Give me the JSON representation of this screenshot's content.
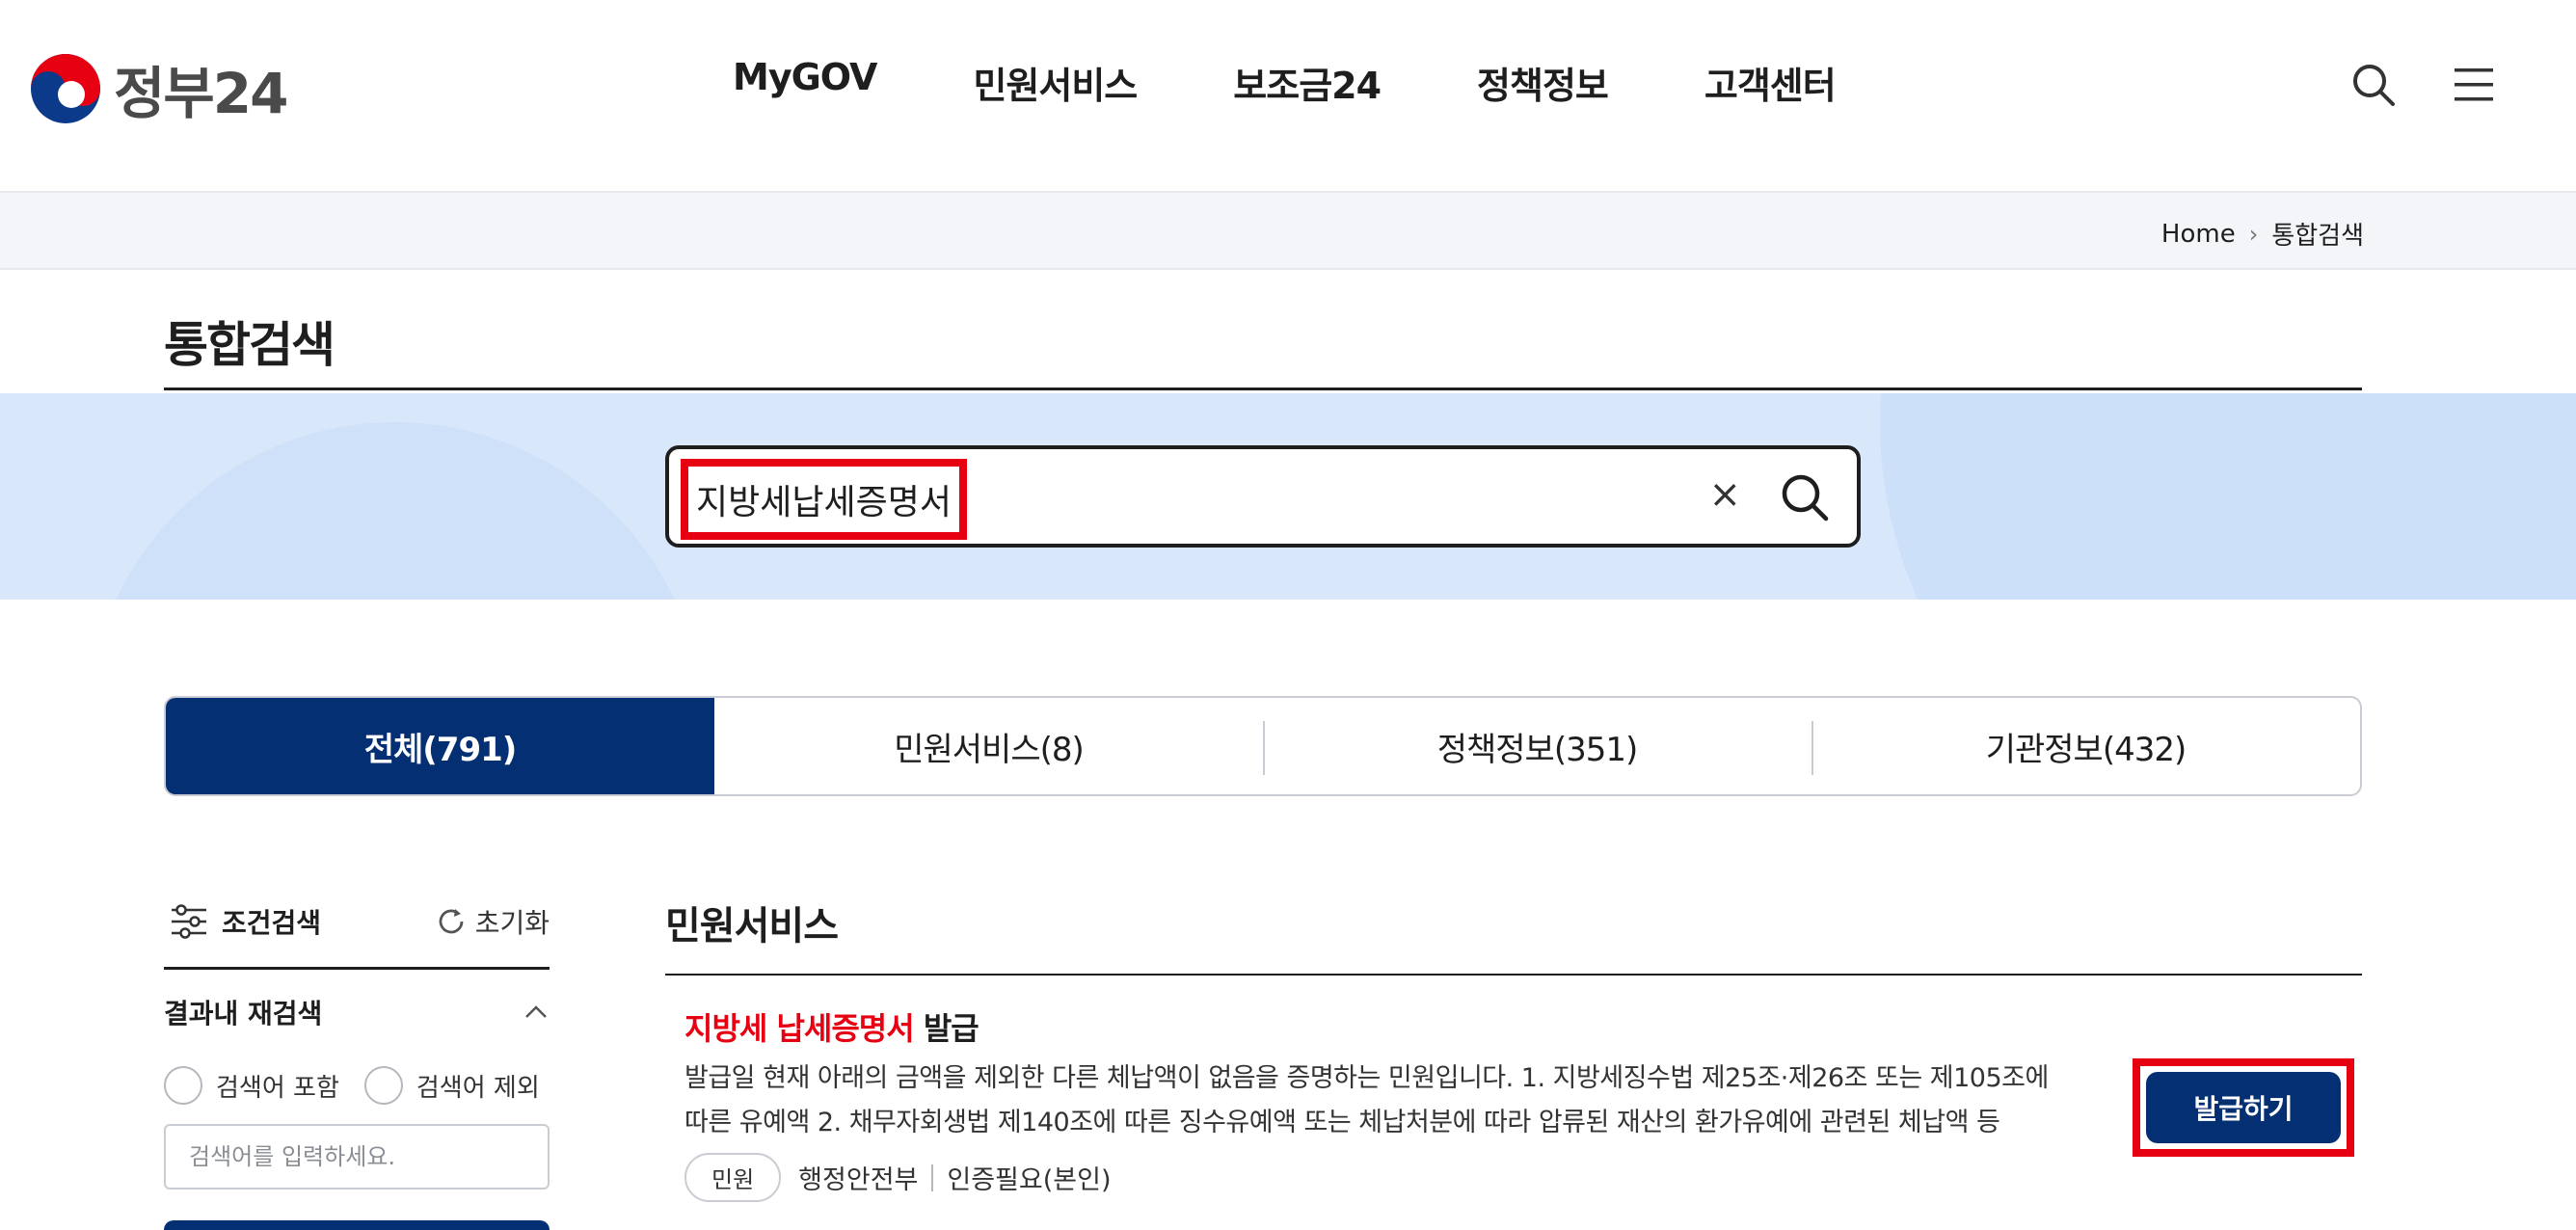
{
  "header": {
    "logo_text": "정부24",
    "nav": [
      "MyGOV",
      "민원서비스",
      "보조금24",
      "정책정보",
      "고객센터"
    ]
  },
  "breadcrumb": {
    "home": "Home",
    "current": "통합검색"
  },
  "page": {
    "title": "통합검색"
  },
  "search": {
    "value": "지방세납세증명서",
    "clear_label": "×"
  },
  "tabs": [
    {
      "label": "전체(791)",
      "active": true
    },
    {
      "label": "민원서비스(8)",
      "active": false
    },
    {
      "label": "정책정보(351)",
      "active": false
    },
    {
      "label": "기관정보(432)",
      "active": false
    }
  ],
  "filter": {
    "title": "조건검색",
    "reset_label": "초기화",
    "refine_title": "결과내 재검색",
    "radio_include": "검색어 포함",
    "radio_exclude": "검색어 제외",
    "input_placeholder": "검색어를 입력하세요."
  },
  "results": {
    "section_title": "민원서비스",
    "item": {
      "title_highlight": "지방세 납세증명서",
      "title_rest": " 발급",
      "desc_line1": "발급일 현재 아래의 금액을 제외한 다른 체납액이 없음을 증명하는 민원입니다. 1. 지방세징수법 제25조·제26조 또는 제105조에",
      "desc_line2": "따른 유예액 2. 채무자회생법 제140조에 따른 징수유예액 또는 체납처분에 따라 압류된 재산의 환가유예에 관련된 체납액 등",
      "tag": "민원",
      "agency": "행정안전부",
      "auth": "인증필요(본인)",
      "action_label": "발급하기"
    }
  },
  "colors": {
    "primary": "#052f73",
    "highlight": "#e60012",
    "band": "#d9e7fb"
  },
  "icons": [
    "taegeuk-logo-icon",
    "search-icon",
    "menu-icon",
    "chevron-right-icon",
    "close-icon",
    "filter-sliders-icon",
    "refresh-icon",
    "chevron-up-icon"
  ]
}
